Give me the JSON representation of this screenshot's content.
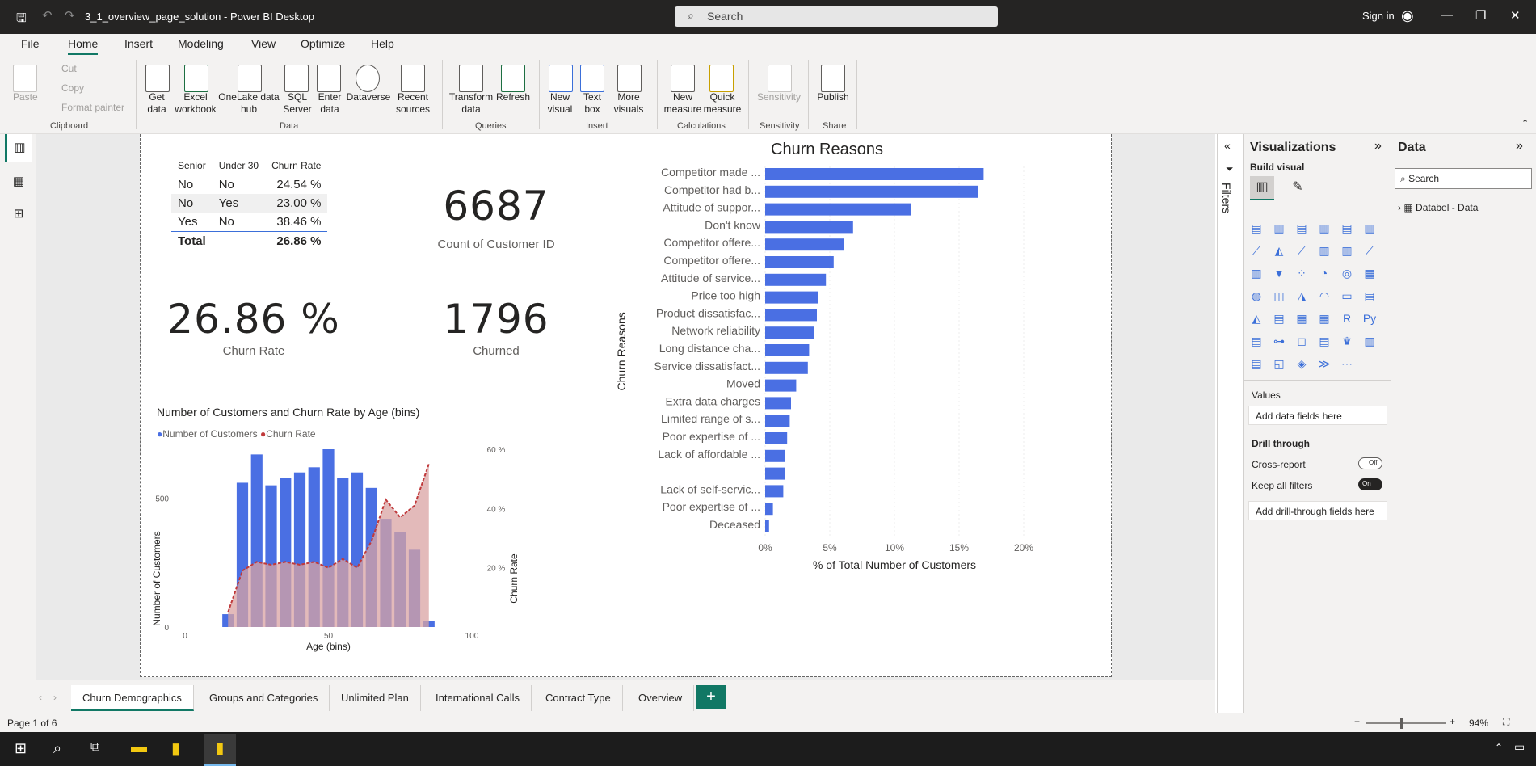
{
  "app": {
    "title": "3_1_overview_page_solution - Power BI Desktop",
    "search": "Search",
    "sign_in": "Sign in"
  },
  "menu": [
    "File",
    "Home",
    "Insert",
    "Modeling",
    "View",
    "Optimize",
    "Help"
  ],
  "ribbon": {
    "clipboard": {
      "paste": "Paste",
      "cut": "Cut",
      "copy": "Copy",
      "format_painter": "Format painter",
      "group": "Clipboard"
    },
    "data": {
      "items": [
        "Get data",
        "Excel workbook",
        "OneLake data hub",
        "SQL Server",
        "Enter data",
        "Dataverse",
        "Recent sources"
      ],
      "group": "Data"
    },
    "queries": {
      "items": [
        "Transform data",
        "Refresh"
      ],
      "group": "Queries"
    },
    "insert": {
      "items": [
        "New visual",
        "Text box",
        "More visuals"
      ],
      "group": "Insert"
    },
    "calculations": {
      "items": [
        "New measure",
        "Quick measure"
      ],
      "group": "Calculations"
    },
    "sensitivity": {
      "items": [
        "Sensitivity"
      ],
      "group": "Sensitivity"
    },
    "share": {
      "items": [
        "Publish"
      ],
      "group": "Share"
    }
  },
  "table": {
    "headers": [
      "Senior",
      "Under 30",
      "Churn Rate"
    ],
    "rows": [
      [
        "No",
        "No",
        "24.54 %"
      ],
      [
        "No",
        "Yes",
        "23.00 %"
      ],
      [
        "Yes",
        "No",
        "38.46 %"
      ]
    ],
    "total": [
      "Total",
      "",
      "26.86 %"
    ]
  },
  "kpis": {
    "count_value": "6687",
    "count_label": "Count of Customer ID",
    "churn_rate_value": "26.86 %",
    "churn_rate_label": "Churn Rate",
    "churned_value": "1796",
    "churned_label": "Churned"
  },
  "combo_chart": {
    "title": "Number of Customers and Churn Rate by Age (bins)",
    "legend": [
      "Number of Customers",
      "Churn Rate"
    ]
  },
  "reasons_chart": {
    "title": "Churn Reasons"
  },
  "colors": {
    "bar": "#4a6fe3",
    "line": "#c0393b",
    "area": "#d9a3a3",
    "accent": "#117865"
  },
  "chart_data": [
    {
      "type": "bar",
      "title": "Churn Reasons",
      "xlabel": "% of Total Number of Customers",
      "ylabel": "Churn Reasons",
      "orientation": "horizontal",
      "xlim": [
        0,
        20
      ],
      "xticks": [
        "0%",
        "5%",
        "10%",
        "15%",
        "20%"
      ],
      "categories": [
        "Competitor made ...",
        "Competitor had b...",
        "Attitude of suppor...",
        "Don't know",
        "Competitor offere...",
        "Competitor offere...",
        "Attitude of service...",
        "Price too high",
        "Product dissatisfac...",
        "Network reliability",
        "Long distance cha...",
        "Service dissatisfact...",
        "Moved",
        "Extra data charges",
        "Limited range of s...",
        "Poor expertise of ...",
        "Lack of affordable ...",
        "",
        "Lack of self-servic...",
        "Poor expertise of ...",
        "Deceased"
      ],
      "values": [
        16.9,
        16.5,
        11.3,
        6.8,
        6.1,
        5.3,
        4.7,
        4.1,
        4.0,
        3.8,
        3.4,
        3.3,
        2.4,
        2.0,
        1.9,
        1.7,
        1.5,
        1.5,
        1.4,
        0.6,
        0.3
      ]
    },
    {
      "type": "bar+area",
      "title": "Number of Customers and Churn Rate by Age (bins)",
      "xlabel": "Age (bins)",
      "ylabel": "Number of Customers",
      "y2label": "Churn Rate",
      "xlim": [
        0,
        100
      ],
      "ylim": [
        0,
        690
      ],
      "y2lim": [
        0,
        60
      ],
      "xticks": [
        "0",
        "50",
        "100"
      ],
      "yticks": [
        "0",
        "500"
      ],
      "y2ticks": [
        "20 %",
        "40 %",
        "60 %"
      ],
      "x": [
        15,
        20,
        25,
        30,
        35,
        40,
        45,
        50,
        55,
        60,
        65,
        70,
        75,
        80,
        85
      ],
      "series": [
        {
          "name": "Number of Customers",
          "values": [
            50,
            560,
            670,
            550,
            580,
            600,
            620,
            690,
            580,
            600,
            540,
            420,
            370,
            300,
            25
          ]
        },
        {
          "name": "Churn Rate",
          "values": [
            5,
            19,
            22,
            21,
            22,
            21,
            22,
            20,
            23,
            20,
            29,
            43,
            37,
            41,
            55
          ]
        }
      ]
    }
  ],
  "viz_pane": {
    "title": "Visualizations",
    "build_visual": "Build visual",
    "values": "Values",
    "add_data": "Add data fields here",
    "drill": "Drill through",
    "cross_report": "Cross-report",
    "cross_state": "Off",
    "keep_filters": "Keep all filters",
    "keep_state": "On",
    "add_drill": "Add drill-through fields here"
  },
  "data_pane": {
    "title": "Data",
    "search": "Search",
    "table": "Databel - Data"
  },
  "filters_label": "Filters",
  "tabs": [
    "Churn Demographics",
    "Groups and Categories",
    "Unlimited Plan",
    "International Calls",
    "Contract Type",
    "Overview"
  ],
  "status": {
    "page": "Page 1 of 6",
    "zoom": "94%"
  }
}
